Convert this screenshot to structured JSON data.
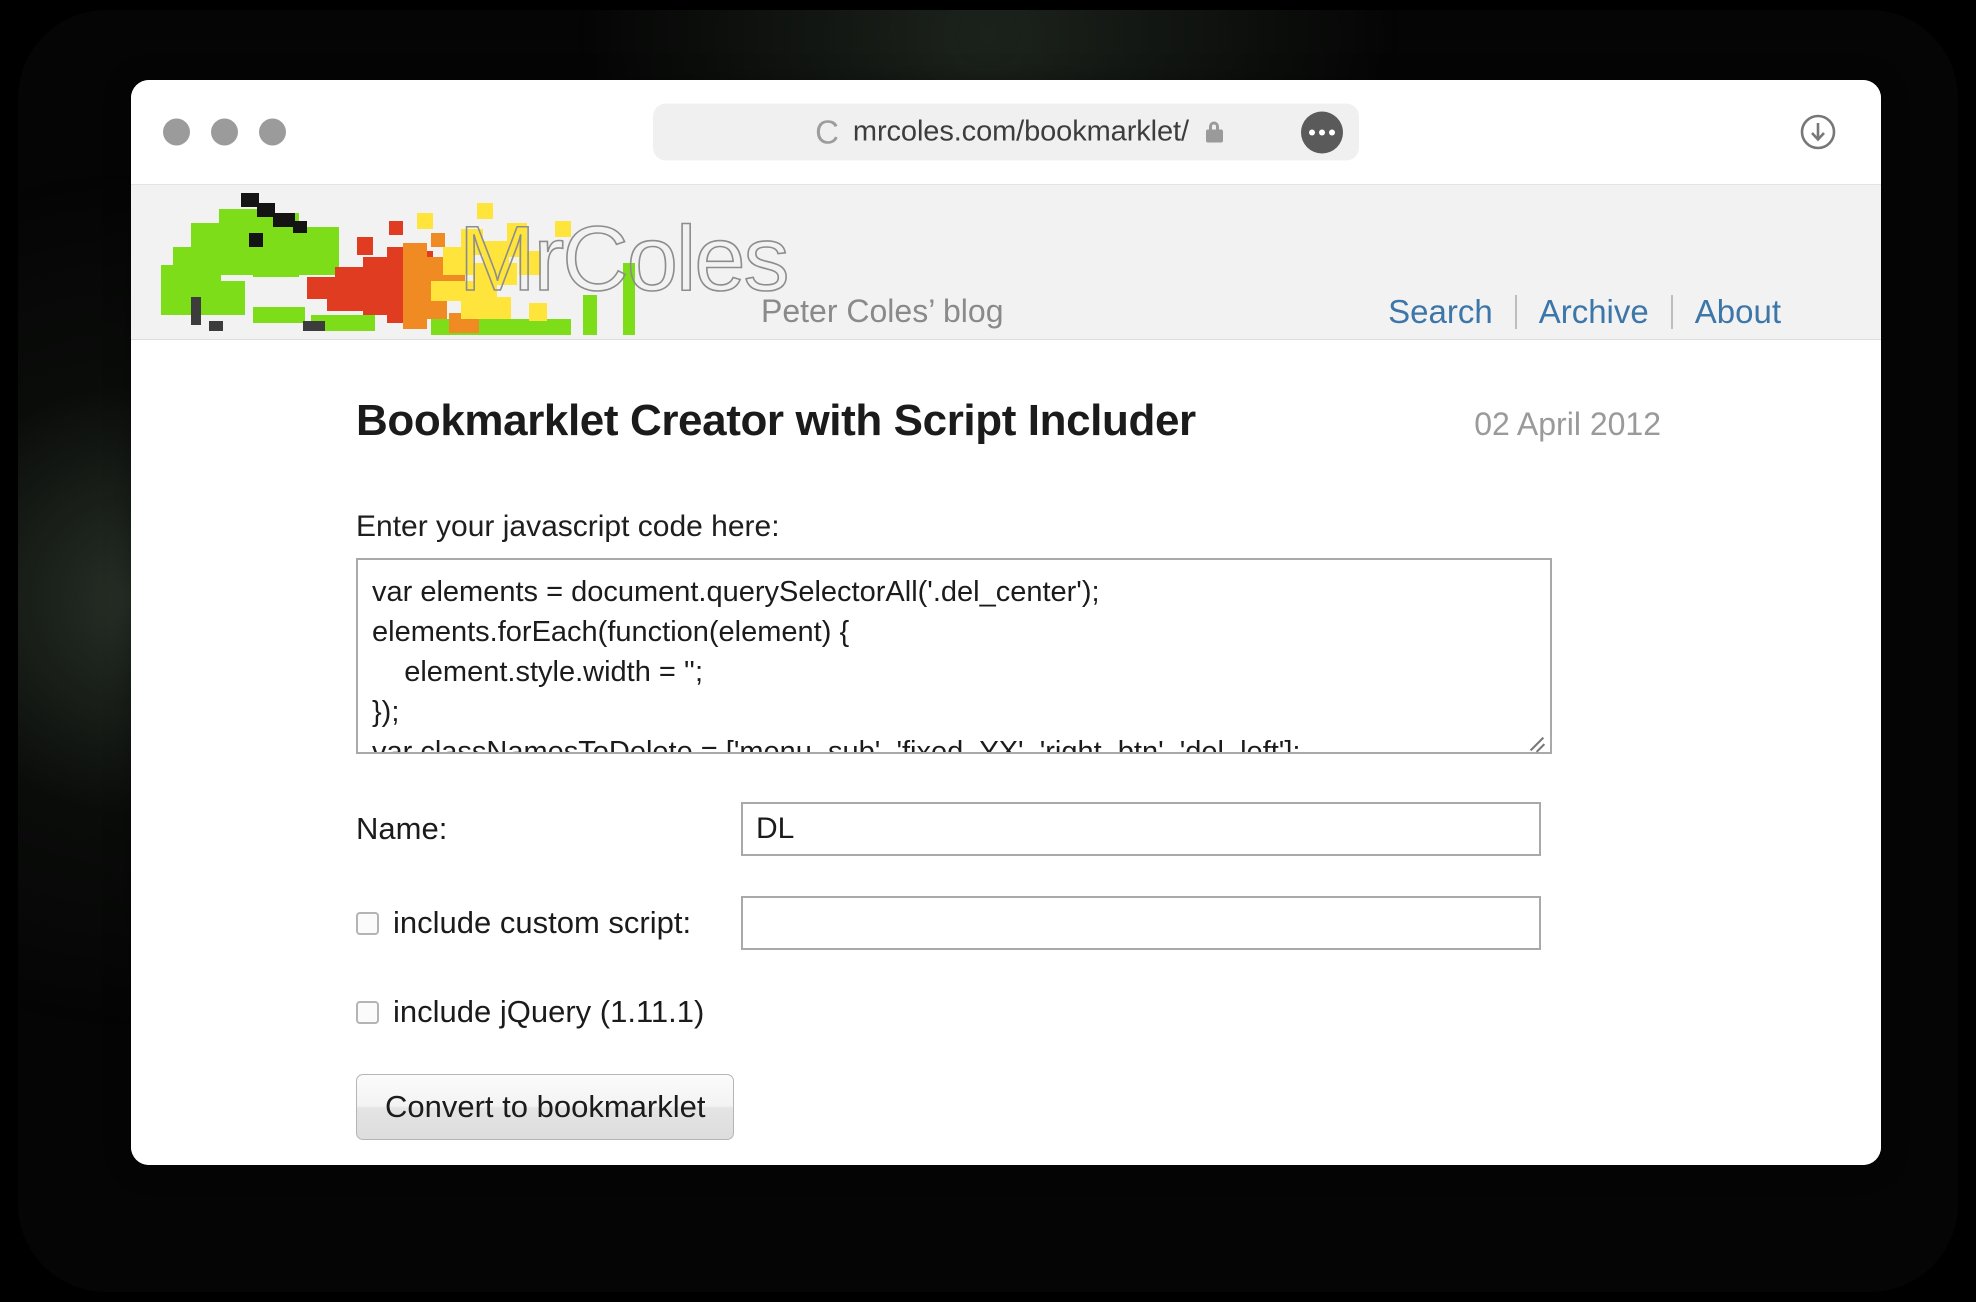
{
  "browser": {
    "window_controls": [
      "close",
      "minimize",
      "maximize"
    ],
    "address": {
      "reader_icon": "c-icon",
      "url": "mrcoles.com/bookmarklet/",
      "lock_icon": "lock-icon",
      "menu_icon": "ellipsis-icon"
    },
    "download_icon": "download-icon"
  },
  "site": {
    "logo_alt": "MrColes",
    "wordmark": "MrColes",
    "tagline": "Peter Coles’ blog",
    "nav": [
      {
        "label": "Search"
      },
      {
        "label": "Archive"
      },
      {
        "label": "About"
      }
    ],
    "nav_link_color": "#3d76a8"
  },
  "page": {
    "title": "Bookmarklet Creator with Script Includer",
    "date": "02 April 2012"
  },
  "form": {
    "code_label": "Enter your javascript code here:",
    "code_value": "var elements = document.querySelectorAll('.del_center');\nelements.forEach(function(element) {\n    element.style.width = '';\n});\nvar classNamesToDelete = ['menu_sub', 'fixed_YX', 'right_btn', 'del_left'];",
    "code_placeholder": "",
    "name_label": "Name:",
    "name_value": "DL",
    "name_placeholder": "",
    "custom_script_label": "include custom script:",
    "custom_script_checked": false,
    "custom_script_value": "",
    "custom_script_placeholder": "",
    "jquery_label": "include jQuery (1.11.1)",
    "jquery_checked": false,
    "submit_label": "Convert to bookmarklet"
  }
}
